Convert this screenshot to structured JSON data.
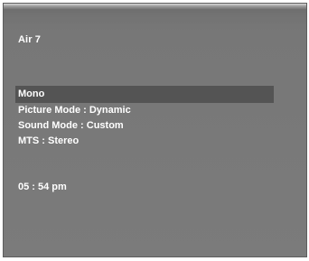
{
  "channel": "Air 7",
  "menu_items": [
    {
      "label": "Mono",
      "selected": true
    },
    {
      "label": "Picture Mode : Dynamic",
      "selected": false
    },
    {
      "label": "Sound Mode : Custom",
      "selected": false
    },
    {
      "label": "MTS : Stereo",
      "selected": false
    }
  ],
  "clock": "05 : 54 pm",
  "colors": {
    "screen_bg": "#777777",
    "highlight": "#545454",
    "text": "#ffffff"
  }
}
